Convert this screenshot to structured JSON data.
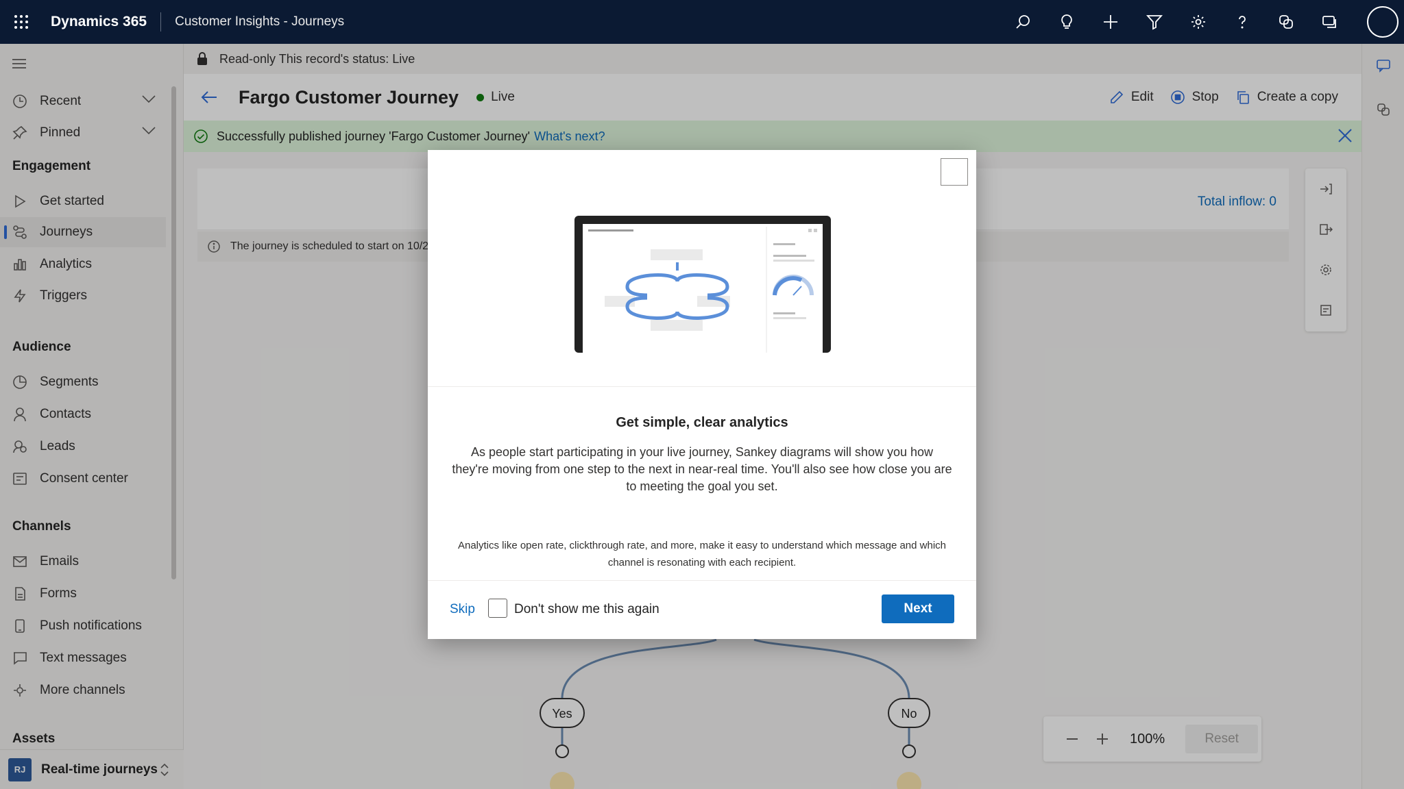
{
  "topbar": {
    "brand": "Dynamics 365",
    "app_name": "Customer Insights - Journeys",
    "icons": [
      "search-icon",
      "lightbulb-icon",
      "add-icon",
      "filter-icon",
      "settings-icon",
      "help-icon",
      "copilot-icon",
      "chat-icon"
    ]
  },
  "nav": {
    "recent": "Recent",
    "pinned": "Pinned",
    "sections": {
      "engagement": "Engagement",
      "audience": "Audience",
      "channels": "Channels",
      "assets": "Assets"
    },
    "engagement_items": [
      "Get started",
      "Journeys",
      "Analytics",
      "Triggers"
    ],
    "audience_items": [
      "Segments",
      "Contacts",
      "Leads",
      "Consent center"
    ],
    "channel_items": [
      "Emails",
      "Forms",
      "Push notifications",
      "Text messages",
      "More channels"
    ],
    "selected": "Journeys",
    "area": {
      "badge": "RJ",
      "label": "Real-time journeys"
    }
  },
  "record": {
    "readonly_text": "Read-only This record's status: Live",
    "title": "Fargo Customer Journey",
    "status": "Live",
    "commands": {
      "edit": "Edit",
      "stop": "Stop",
      "copy": "Create a copy"
    }
  },
  "banner": {
    "message": "Successfully published journey 'Fargo Customer Journey'",
    "link": "What's next?"
  },
  "canvas": {
    "total_inflow": "Total inflow: 0",
    "schedule_note": "The journey is scheduled to start on 10/2",
    "branch_yes": "Yes",
    "branch_no": "No",
    "zoom": "100%",
    "reset": "Reset"
  },
  "dialog": {
    "title": "Get simple, clear analytics",
    "body": "As people start participating in your live journey, Sankey diagrams will show you how they're moving from one step to the next in near-real time. You'll also see how close you are to meeting the goal you set.",
    "note": "Analytics like open rate, clickthrough rate, and more, make it easy to understand which message and which channel is resonating with each recipient.",
    "skip": "Skip",
    "checkbox_label": "Don't show me this again",
    "next": "Next"
  },
  "colors": {
    "topbar": "#0b1a33",
    "accent": "#0f6cbd",
    "live": "#107c10",
    "banner": "#dff6dd"
  }
}
